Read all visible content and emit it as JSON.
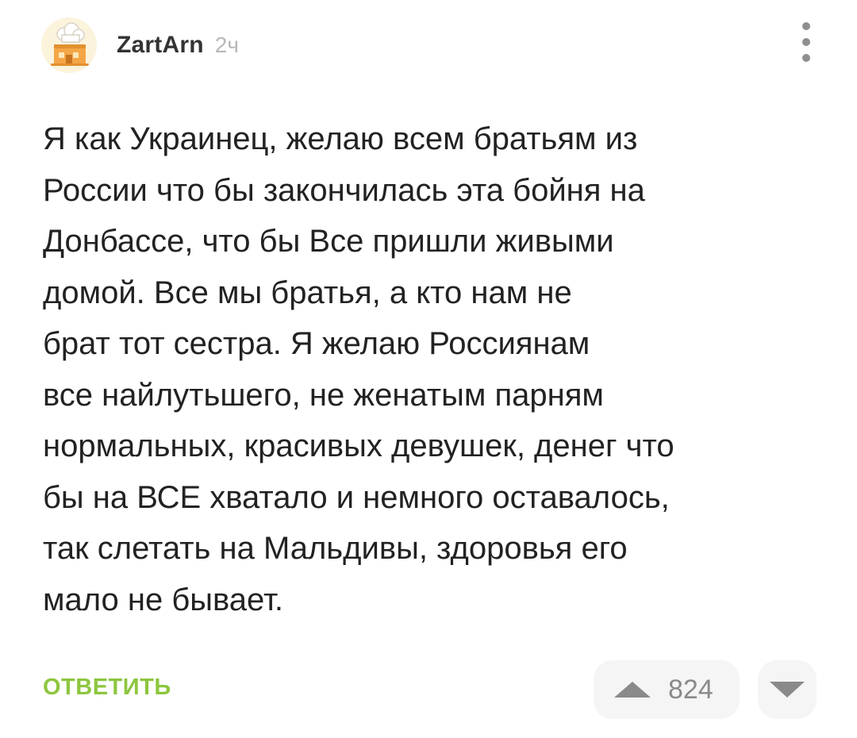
{
  "comment": {
    "author": "ZartArn",
    "time": "2ч",
    "avatar_icon": "chef-hat-house-avatar",
    "text_lines": [
      "Я как Украинец, желаю всем братьям из",
      "России что бы закончилась эта бойня на",
      "Донбассе, что бы Все пришли живыми",
      "домой. Все мы братья, а кто нам не",
      "брат тот сестра. Я желаю Россиянам",
      "все найлутьшего, не женатым парням",
      "нормальных, красивых девушек, денег что",
      "бы на ВСЕ хватало и немного оставалось,",
      "так слетать на Мальдивы, здоровья его",
      "мало не бывает."
    ],
    "reply_label": "ОТВЕТИТЬ",
    "rating": "824",
    "more_icon": "more-vertical-icon",
    "upvote_icon": "upvote-triangle-icon",
    "downvote_icon": "downvote-triangle-icon"
  },
  "colors": {
    "reply": "#8dc63f",
    "time": "#b8b8b8",
    "vote_bg": "#f5f5f5",
    "vote_icon": "#8a8a8a",
    "text": "#222222"
  }
}
